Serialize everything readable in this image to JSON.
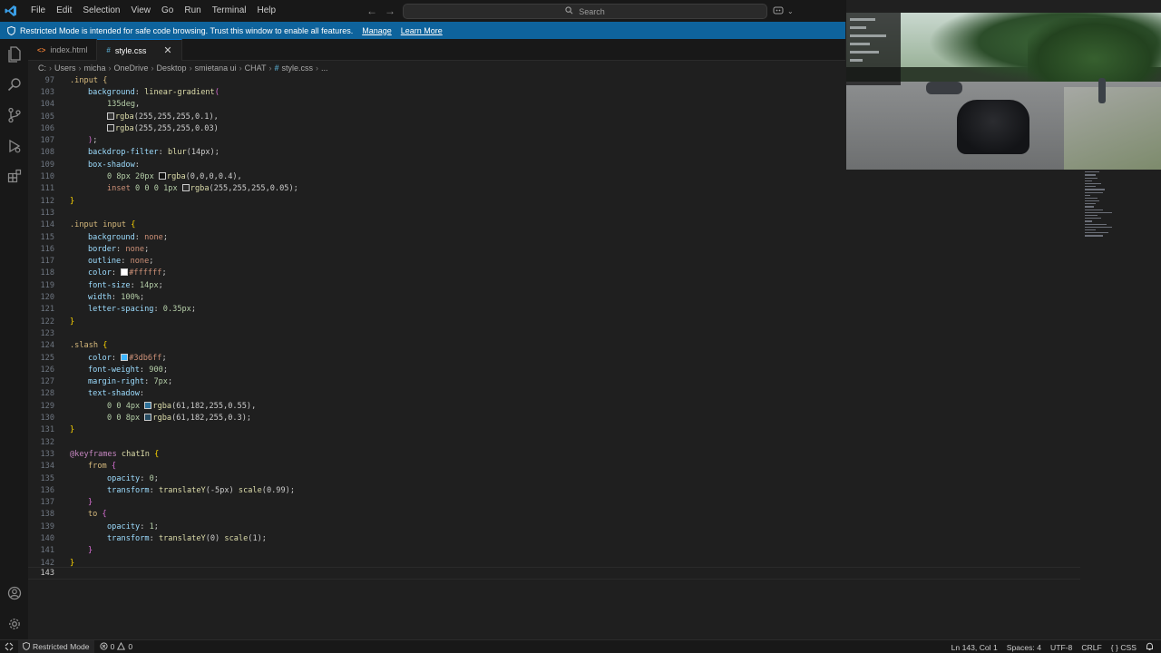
{
  "menu": [
    "File",
    "Edit",
    "Selection",
    "View",
    "Go",
    "Run",
    "Terminal",
    "Help"
  ],
  "search": {
    "label": "Search"
  },
  "banner": {
    "text": "Restricted Mode is intended for safe code browsing. Trust this window to enable all features.",
    "manage": "Manage",
    "learn_more": "Learn More"
  },
  "tabs": [
    {
      "label": "index.html",
      "icon": "<>"
    },
    {
      "label": "style.css",
      "icon": "#"
    }
  ],
  "breadcrumb": [
    "C:",
    "Users",
    "micha",
    "OneDrive",
    "Desktop",
    "smietana ui",
    "CHAT",
    "style.css",
    "..."
  ],
  "breadcrumb_icon": "#",
  "editor": {
    "sticky_line_number": "97",
    "sticky_code": ".input {",
    "line_numbers": [
      "103",
      "104",
      "105",
      "106",
      "107",
      "108",
      "109",
      "110",
      "111",
      "112",
      "113",
      "114",
      "115",
      "116",
      "117",
      "118",
      "119",
      "120",
      "121",
      "122",
      "123",
      "124",
      "125",
      "126",
      "127",
      "128",
      "129",
      "130",
      "131",
      "132",
      "133",
      "134",
      "135",
      "136",
      "137",
      "138",
      "139",
      "140",
      "141",
      "142",
      "143"
    ],
    "lines": {
      "l103a": "background",
      "l103b": ": ",
      "l103c": "linear-gradient",
      "l103d": "(",
      "l104a": "135deg",
      "l104b": ",",
      "l105a": "rgba",
      "l105b": "(255,255,255,0.1),",
      "l106a": "rgba",
      "l106b": "(255,255,255,0.03)",
      "l107a": ")",
      "l107b": ";",
      "l108a": "backdrop-filter",
      "l108b": ": ",
      "l108c": "blur",
      "l108d": "(14px);",
      "l109a": "box-shadow",
      "l109b": ":",
      "l110a": "0 8px 20px ",
      "l110b": "rgba",
      "l110c": "(0,0,0,0.4),",
      "l111a": "inset",
      "l111b": " 0 0 0 1px ",
      "l111c": "rgba",
      "l111d": "(255,255,255,0.05);",
      "l112a": "}",
      "l114a": ".input input",
      "l114b": " {",
      "l115a": "background",
      "l115b": ": ",
      "l115c": "none",
      "l115d": ";",
      "l116a": "border",
      "l116b": ": ",
      "l116c": "none",
      "l116d": ";",
      "l117a": "outline",
      "l117b": ": ",
      "l117c": "none",
      "l117d": ";",
      "l118a": "color",
      "l118b": ": ",
      "l118c": "#ffffff",
      "l118d": ";",
      "l119a": "font-size",
      "l119b": ": ",
      "l119c": "14px",
      "l119d": ";",
      "l120a": "width",
      "l120b": ": ",
      "l120c": "100%",
      "l120d": ";",
      "l121a": "letter-spacing",
      "l121b": ": ",
      "l121c": "0.35px",
      "l121d": ";",
      "l122a": "}",
      "l124a": ".slash",
      "l124b": " {",
      "l125a": "color",
      "l125b": ": ",
      "l125c": "#3db6ff",
      "l125d": ";",
      "l126a": "font-weight",
      "l126b": ": ",
      "l126c": "900",
      "l126d": ";",
      "l127a": "margin-right",
      "l127b": ": ",
      "l127c": "7px",
      "l127d": ";",
      "l128a": "text-shadow",
      "l128b": ":",
      "l129a": "0 0 4px ",
      "l129b": "rgba",
      "l129c": "(61,182,255,0.55),",
      "l130a": "0 0 8px ",
      "l130b": "rgba",
      "l130c": "(61,182,255,0.3);",
      "l131a": "}",
      "l133a": "@keyframes",
      "l133b": " chatIn ",
      "l133c": "{",
      "l134a": "from",
      "l134b": " {",
      "l135a": "opacity",
      "l135b": ": ",
      "l135c": "0",
      "l135d": ";",
      "l136a": "transform",
      "l136b": ": ",
      "l136c": "translateY",
      "l136d": "(-5px) ",
      "l136e": "scale",
      "l136f": "(0.99);",
      "l137a": "}",
      "l138a": "to",
      "l138b": " {",
      "l139a": "opacity",
      "l139b": ": ",
      "l139c": "1",
      "l139d": ";",
      "l140a": "transform",
      "l140b": ": ",
      "l140c": "translateY",
      "l140d": "(0) ",
      "l140e": "scale",
      "l140f": "(1);",
      "l141a": "}",
      "l142a": "}"
    }
  },
  "colors": {
    "swatch_white": "#ffffff",
    "swatch_blue": "#3db6ff",
    "banner_bg": "#0e639c",
    "editor_bg": "#1f1f1f"
  },
  "statusbar": {
    "restricted": "Restricted Mode",
    "errors": "0",
    "warnings": "0",
    "position": "Ln 143, Col 1",
    "spaces": "Spaces: 4",
    "encoding": "UTF-8",
    "eol": "CRLF",
    "language": "CSS"
  },
  "icons": [
    "vscode-logo-icon",
    "arrow-left-icon",
    "arrow-right-icon",
    "search-icon",
    "copilot-icon",
    "shield-icon",
    "explorer-icon",
    "search-sidebar-icon",
    "source-control-icon",
    "run-debug-icon",
    "extensions-icon",
    "account-icon",
    "settings-gear-icon",
    "remote-icon",
    "error-icon",
    "warning-icon",
    "bell-icon",
    "close-icon"
  ]
}
